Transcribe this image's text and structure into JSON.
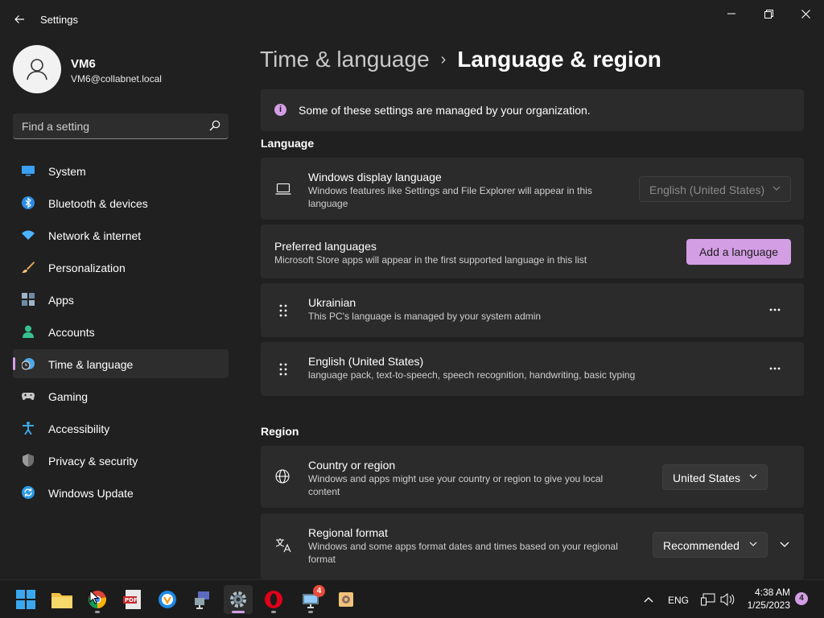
{
  "window": {
    "title": "Settings",
    "controls": [
      "minimize",
      "restore",
      "close"
    ]
  },
  "profile": {
    "name": "VM6",
    "email": "VM6@collabnet.local"
  },
  "search": {
    "placeholder": "Find a setting"
  },
  "sidebar": {
    "items": [
      {
        "label": "System",
        "icon": "monitor-icon",
        "color": "#3aa0f3"
      },
      {
        "label": "Bluetooth & devices",
        "icon": "bluetooth-icon",
        "color": "#2b8ce6"
      },
      {
        "label": "Network & internet",
        "icon": "wifi-icon",
        "color": "#4cb4ff"
      },
      {
        "label": "Personalization",
        "icon": "brush-icon",
        "color": "#e8a65b"
      },
      {
        "label": "Apps",
        "icon": "apps-icon",
        "color": "#9fb4c8"
      },
      {
        "label": "Accounts",
        "icon": "person-icon",
        "color": "#36c28e"
      },
      {
        "label": "Time & language",
        "icon": "clock-globe-icon",
        "color": "#4aa8e8",
        "selected": true
      },
      {
        "label": "Gaming",
        "icon": "gamepad-icon",
        "color": "#c7c7c7"
      },
      {
        "label": "Accessibility",
        "icon": "accessibility-icon",
        "color": "#3ea7e5"
      },
      {
        "label": "Privacy & security",
        "icon": "shield-icon",
        "color": "#9a9a9a"
      },
      {
        "label": "Windows Update",
        "icon": "update-icon",
        "color": "#2a9ae6"
      }
    ]
  },
  "breadcrumb": {
    "parent": "Time & language",
    "separator": "›",
    "current": "Language & region"
  },
  "banner": {
    "text": "Some of these settings are managed by your organization."
  },
  "language": {
    "heading": "Language",
    "display": {
      "title": "Windows display language",
      "subtitle": "Windows features like Settings and File Explorer will appear in this language",
      "value": "English (United States)"
    },
    "preferred": {
      "title": "Preferred languages",
      "subtitle": "Microsoft Store apps will appear in the first supported language in this list",
      "add_label": "Add a language"
    },
    "list": [
      {
        "name": "Ukrainian",
        "detail": "This PC's language is managed by your system admin"
      },
      {
        "name": "English (United States)",
        "detail": "language pack, text-to-speech, speech recognition, handwriting, basic typing"
      }
    ]
  },
  "region": {
    "heading": "Region",
    "country": {
      "title": "Country or region",
      "subtitle": "Windows and apps might use your country or region to give you local content",
      "value": "United States"
    },
    "format": {
      "title": "Regional format",
      "subtitle": "Windows and some apps format dates and times based on your regional format",
      "value": "Recommended"
    }
  },
  "taskbar": {
    "apps": [
      "start-icon",
      "file-explorer-icon",
      "chrome-icon",
      "pdf-icon",
      "vpn-icon",
      "network-manager-icon",
      "settings-icon",
      "opera-icon",
      "remote-desktop-icon",
      "package-icon"
    ],
    "badge_count": "4",
    "tray": {
      "lang": "ENG",
      "time": "4:38 AM",
      "date": "1/25/2023",
      "notifications": "4"
    }
  },
  "colors": {
    "accent": "#d49ee5",
    "background": "#202020",
    "card": "#2b2b2b"
  }
}
